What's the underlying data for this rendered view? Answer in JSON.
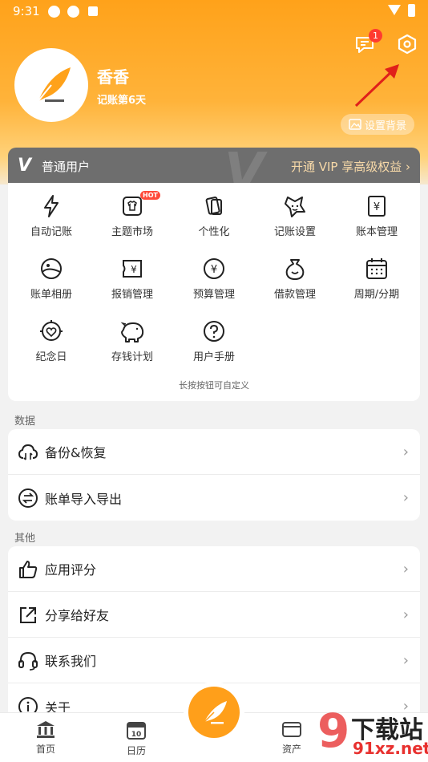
{
  "status_bar": {
    "time": "9:31"
  },
  "profile": {
    "name": "香香",
    "days": "记账第6天",
    "message_count": "1",
    "set_background": "设置背景"
  },
  "vip": {
    "logo": "V",
    "title": "普通用户",
    "link": "开通 VIP 享高级权益 ›"
  },
  "grid": {
    "items": [
      {
        "label": "自动记账",
        "icon": "lightning-icon"
      },
      {
        "label": "主题市场",
        "icon": "tshirt-icon",
        "badge": "HOT"
      },
      {
        "label": "个性化",
        "icon": "cards-icon"
      },
      {
        "label": "记账设置",
        "icon": "star-face-icon"
      },
      {
        "label": "账本管理",
        "icon": "ledger-icon"
      },
      {
        "label": "账单相册",
        "icon": "album-icon"
      },
      {
        "label": "报销管理",
        "icon": "reimburse-icon"
      },
      {
        "label": "预算管理",
        "icon": "budget-icon"
      },
      {
        "label": "借款管理",
        "icon": "money-bag-icon"
      },
      {
        "label": "周期/分期",
        "icon": "calendar-icon"
      },
      {
        "label": "纪念日",
        "icon": "anniversary-icon"
      },
      {
        "label": "存钱计划",
        "icon": "piggy-bank-icon"
      },
      {
        "label": "用户手册",
        "icon": "help-icon"
      }
    ],
    "hint": "长按按钮可自定义"
  },
  "sections": {
    "data_title": "数据",
    "data_rows": [
      {
        "label": "备份&恢复",
        "icon": "cloud-sync-icon"
      },
      {
        "label": "账单导入导出",
        "icon": "import-export-icon"
      }
    ],
    "other_title": "其他",
    "other_rows": [
      {
        "label": "应用评分",
        "icon": "thumbs-up-icon"
      },
      {
        "label": "分享给好友",
        "icon": "share-icon"
      },
      {
        "label": "联系我们",
        "icon": "headset-icon"
      },
      {
        "label": "关于",
        "icon": "info-icon"
      }
    ]
  },
  "tabbar": {
    "home": "首页",
    "calendar": "日历",
    "calendar_day": "10",
    "assets": "资产"
  },
  "watermark": {
    "line1": "下载站",
    "line2": "91xz.net",
    "digit": "9"
  },
  "colors": {
    "primary": "#ffa21a",
    "vip_bar": "#6e6e6e",
    "badge": "#ff3b30"
  }
}
